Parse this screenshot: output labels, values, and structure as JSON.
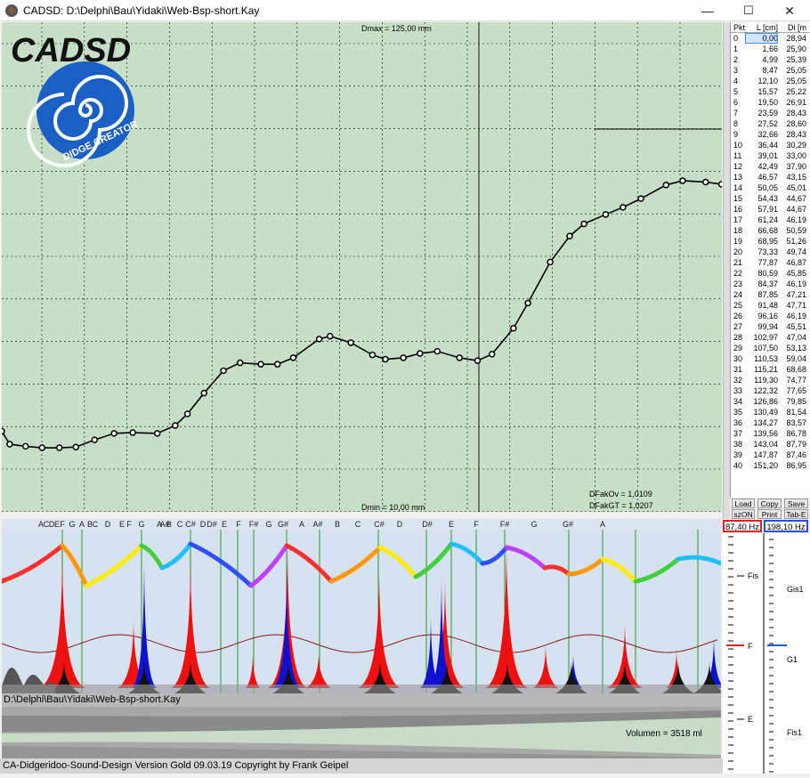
{
  "window": {
    "title": "CADSD: D:\\Delphi\\Bau\\Yidaki\\Web-Bsp-short.Kay",
    "minimize": "—",
    "maximize": "☐",
    "close": "✕"
  },
  "logo": {
    "text": "CADSD",
    "subtitle": "DIDGE CREATOR",
    "colors": {
      "text": "#111111",
      "swirl": "#1a5fc4"
    }
  },
  "plot": {
    "dmax_label": "Dmax = 125,00 mm",
    "dmin_label": "Dmin = 10,00 mm",
    "dfak_ov": "DFakOv = 1,0109",
    "dfak_gt": "DFakGT = 1,0207",
    "colors": {
      "background": "#c6dfc6",
      "grid": "#000000",
      "curve": "#000000"
    }
  },
  "chart_data": {
    "type": "line",
    "title": "",
    "xlabel": "L [cm]",
    "ylabel": "Di",
    "ylim": [
      10,
      125
    ],
    "x": [
      0.0,
      1.66,
      4.99,
      8.47,
      12.1,
      15.57,
      19.5,
      23.59,
      27.52,
      32.66,
      36.44,
      39.01,
      42.49,
      46.57,
      50.05,
      54.43,
      57.91,
      61.24,
      66.68,
      68.95,
      73.33,
      77.87,
      80.59,
      84.37,
      87.85,
      91.48,
      96.16,
      99.94,
      102.97,
      107.5,
      110.53,
      115.21,
      119.3,
      122.32,
      126.86,
      130.49,
      134.27,
      139.56,
      143.04,
      147.87,
      151.2
    ],
    "y": [
      28.94,
      25.9,
      25.39,
      25.05,
      25.05,
      25.22,
      26.91,
      28.43,
      28.6,
      28.43,
      30.29,
      33.0,
      37.9,
      43.15,
      45.01,
      44.67,
      44.67,
      46.19,
      50.59,
      51.26,
      49.74,
      46.87,
      45.85,
      46.19,
      47.21,
      47.71,
      46.19,
      45.51,
      47.04,
      53.13,
      59.04,
      68.68,
      74.77,
      77.65,
      79.85,
      81.54,
      83.57,
      86.78,
      87.79,
      87.46,
      86.95
    ]
  },
  "table": {
    "headers": [
      "Pkt",
      "L [cm]",
      "Di [m"
    ],
    "rows": [
      [
        "0",
        "0,00",
        "28,94"
      ],
      [
        "1",
        "1,66",
        "25,90"
      ],
      [
        "2",
        "4,99",
        "25,39"
      ],
      [
        "3",
        "8,47",
        "25,05"
      ],
      [
        "4",
        "12,10",
        "25,05"
      ],
      [
        "5",
        "15,57",
        "25,22"
      ],
      [
        "6",
        "19,50",
        "26,91"
      ],
      [
        "7",
        "23,59",
        "28,43"
      ],
      [
        "8",
        "27,52",
        "28,60"
      ],
      [
        "9",
        "32,66",
        "28,43"
      ],
      [
        "10",
        "36,44",
        "30,29"
      ],
      [
        "11",
        "39,01",
        "33,00"
      ],
      [
        "12",
        "42,49",
        "37,90"
      ],
      [
        "13",
        "46,57",
        "43,15"
      ],
      [
        "14",
        "50,05",
        "45,01"
      ],
      [
        "15",
        "54,43",
        "44,67"
      ],
      [
        "16",
        "57,91",
        "44,67"
      ],
      [
        "17",
        "61,24",
        "46,19"
      ],
      [
        "18",
        "66,68",
        "50,59"
      ],
      [
        "19",
        "68,95",
        "51,26"
      ],
      [
        "20",
        "73,33",
        "49,74"
      ],
      [
        "21",
        "77,87",
        "46,87"
      ],
      [
        "22",
        "80,59",
        "45,85"
      ],
      [
        "23",
        "84,37",
        "46,19"
      ],
      [
        "24",
        "87,85",
        "47,21"
      ],
      [
        "25",
        "91,48",
        "47,71"
      ],
      [
        "26",
        "96,16",
        "46,19"
      ],
      [
        "27",
        "99,94",
        "45,51"
      ],
      [
        "28",
        "102,97",
        "47,04"
      ],
      [
        "29",
        "107,50",
        "53,13"
      ],
      [
        "30",
        "110,53",
        "59,04"
      ],
      [
        "31",
        "115,21",
        "68,68"
      ],
      [
        "32",
        "119,30",
        "74,77"
      ],
      [
        "33",
        "122,32",
        "77,65"
      ],
      [
        "34",
        "126,86",
        "79,85"
      ],
      [
        "35",
        "130,49",
        "81,54"
      ],
      [
        "36",
        "134,27",
        "83,57"
      ],
      [
        "37",
        "139,56",
        "86,78"
      ],
      [
        "38",
        "143,04",
        "87,79"
      ],
      [
        "39",
        "147,87",
        "87,46"
      ],
      [
        "40",
        "151,20",
        "86,95"
      ]
    ],
    "selected_row": 0,
    "buttons": {
      "load": "Load",
      "copy": "Copy",
      "save": "Save",
      "szon": "szON",
      "print": "Print",
      "tab_e": "Tab-E"
    }
  },
  "spectrum": {
    "note_labels": [
      "A",
      "C",
      "D",
      "E",
      "F",
      "G",
      "A",
      "B",
      "C",
      "D",
      "E",
      "F",
      "G",
      "A",
      "A#",
      "B",
      "C",
      "C#",
      "D",
      "D#",
      "E",
      "F",
      "F#",
      "G",
      "G#",
      "A",
      "A#",
      "B",
      "C",
      "C#",
      "D",
      "D#",
      "E",
      "F",
      "F#",
      "G",
      "G#",
      "A"
    ],
    "colors": {
      "background": "#d6e2ef",
      "peak_red": "#ee1111",
      "peak_blue": "#1010d0",
      "baseline": "#222222",
      "envelope": "#8b1a1a"
    }
  },
  "file_path": "D:\\Delphi\\Bau\\Yidaki\\Web-Bsp-short.Kay",
  "volume": "Volumen = 3518 ml",
  "footer": "CA-Didgeridoo-Sound-Design Version Gold 09.03.19 Copyright by Frank Geipel",
  "freq": {
    "f1": "87,40 Hz",
    "f2": "198,10 Hz",
    "colors": {
      "f1_border": "#d22",
      "f2_border": "#2255dd"
    }
  },
  "note_scale": {
    "left_notes": [
      "Fis",
      "F",
      "E"
    ],
    "right_notes": [
      "Gis1",
      "G1",
      "Fis1"
    ]
  }
}
